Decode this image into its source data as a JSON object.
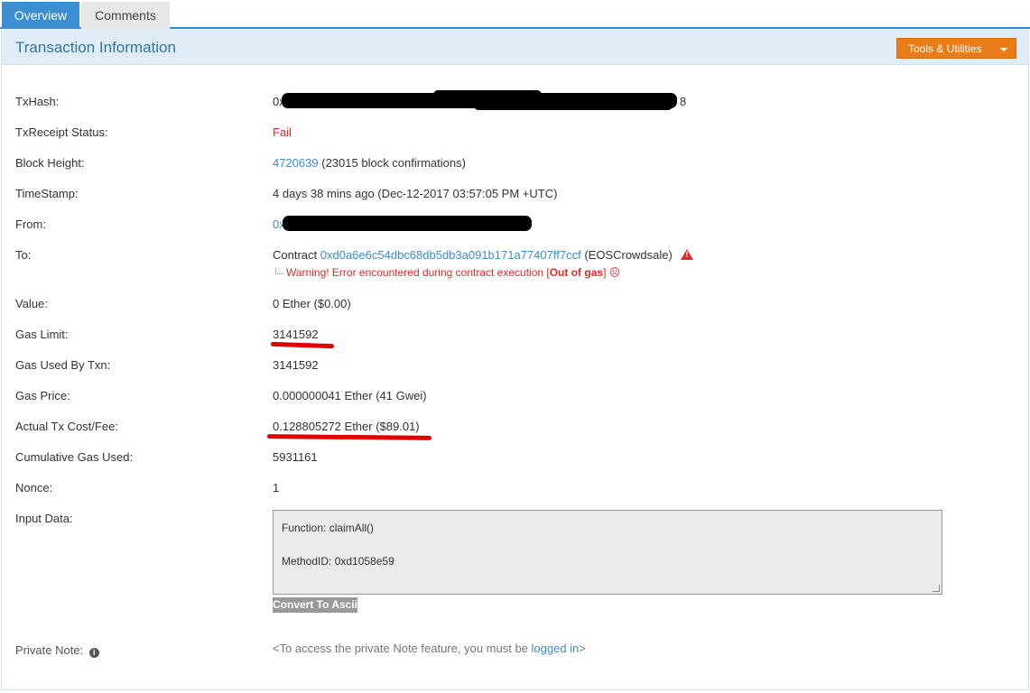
{
  "tabs": {
    "overview": "Overview",
    "comments": "Comments"
  },
  "header": {
    "title": "Transaction Information",
    "tools_label": "Tools & Utilities"
  },
  "rows": {
    "txhash": {
      "label": "TxHash:",
      "prefix": "0x",
      "suffix": "8"
    },
    "status": {
      "label": "TxReceipt Status:",
      "value": "Fail"
    },
    "block": {
      "label": "Block Height:",
      "link": "4720639",
      "rest": "(23015 block confirmations)"
    },
    "timestamp": {
      "label": "TimeStamp:",
      "value": "4 days 38 mins ago (Dec-12-2017 03:57:05 PM +UTC)"
    },
    "from": {
      "label": "From:",
      "prefix": "0x"
    },
    "to": {
      "label": "To:",
      "contract_word": "Contract",
      "address": "0xd0a6e6c54dbc68db5db3a091b171a77407ff7ccf",
      "name": "(EOSCrowdsale)",
      "warning_pre": "Warning! Error encountered during contract execution [",
      "warning_bold": "Out of gas",
      "warning_post": "]",
      "warning_face": "☹"
    },
    "value": {
      "label": "Value:",
      "value": "0 Ether ($0.00)"
    },
    "gas_limit": {
      "label": "Gas Limit:",
      "value": "3141592"
    },
    "gas_used": {
      "label": "Gas Used By Txn:",
      "value": "3141592"
    },
    "gas_price": {
      "label": "Gas Price:",
      "value": "0.000000041 Ether (41 Gwei)"
    },
    "fee": {
      "label": "Actual Tx Cost/Fee:",
      "value": "0.128805272 Ether ($89.01)"
    },
    "cumulative": {
      "label": "Cumulative Gas Used:",
      "value": "5931161"
    },
    "nonce": {
      "label": "Nonce:",
      "value": "1"
    },
    "input": {
      "label": "Input Data:",
      "line1": "Function: claimAll()",
      "line2": "MethodID: 0xd1058e59",
      "convert_label": "Convert To Ascii"
    },
    "private_note": {
      "label": "Private Note:",
      "text_pre": "<To access the private Note feature, you must be ",
      "link": "logged in",
      "text_post": ">"
    }
  },
  "colors": {
    "accent": "#3b8fd0",
    "fail": "#e52929",
    "tools": "#e77c18",
    "header_bg": "#deedf8"
  }
}
